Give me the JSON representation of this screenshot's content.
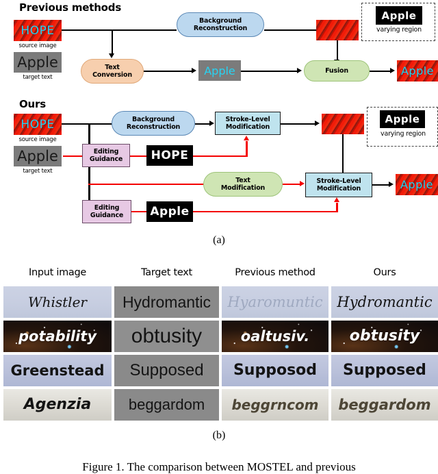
{
  "figure": {
    "subfigure_a_label": "(a)",
    "subfigure_b_label": "(b)",
    "caption": "Figure 1.  The comparison between MOSTEL and previous"
  },
  "panel_a": {
    "previous": {
      "title": "Previous methods",
      "source_image_label": "source image",
      "source_image_text": "HOPE",
      "target_text_label": "target text",
      "target_text_value": "Apple",
      "nodes": [
        {
          "id": "background-reconstruction",
          "line1": "Background",
          "line2": "Reconstruction",
          "color": "#bcd8ef"
        },
        {
          "id": "text-conversion",
          "line1": "Text",
          "line2": "Conversion",
          "color": "#f7cfae"
        },
        {
          "id": "fusion",
          "line1": "Fusion",
          "line2": "",
          "color": "#cfe5b4"
        }
      ],
      "converted_text": "Apple",
      "output_text": "Apple",
      "varying_region_label": "varying region",
      "varying_region_text": "Apple"
    },
    "ours": {
      "title": "Ours",
      "source_image_label": "source image",
      "source_image_text": "HOPE",
      "target_text_label": "target text",
      "target_text_value": "Apple",
      "nodes": [
        {
          "id": "background-reconstruction",
          "line1": "Background",
          "line2": "Reconstruction",
          "color": "#bcd8ef"
        },
        {
          "id": "stroke-level-modification-top",
          "line1": "Stroke-Level",
          "line2": "Modification",
          "color": "#bfe3ee"
        },
        {
          "id": "editing-guidance-top",
          "line1": "Editing",
          "line2": "Guidance",
          "color": "#e7c9e4"
        },
        {
          "id": "text-modification",
          "line1": "Text",
          "line2": "Modification",
          "color": "#cfe5b4"
        },
        {
          "id": "stroke-level-modification-bottom",
          "line1": "Stroke-Level",
          "line2": "Modification",
          "color": "#bfe3ee"
        },
        {
          "id": "editing-guidance-bottom",
          "line1": "Editing",
          "line2": "Guidance",
          "color": "#e7c9e4"
        }
      ],
      "mask_hope": "HOPE",
      "mask_apple": "Apple",
      "output_text": "Apple",
      "varying_region_label": "varying region",
      "varying_region_text": "Apple"
    }
  },
  "panel_b": {
    "headers": [
      "Input image",
      "Target text",
      "Previous method",
      "Ours"
    ],
    "rows": [
      {
        "input_image": "Whistler",
        "target_text": "Hydromantic",
        "previous_method": "Hyaromuntic",
        "ours": "Hydromantic"
      },
      {
        "input_image": "potability",
        "target_text": "obtusity",
        "previous_method": "oaltusiv.",
        "ours": "obtusity"
      },
      {
        "input_image": "Greenstead",
        "target_text": "Supposed",
        "previous_method": "Supposod",
        "ours": "Supposed"
      },
      {
        "input_image": "Agenzia",
        "target_text": "beggardom",
        "previous_method": "beggrncom",
        "ours": "beggardom"
      }
    ]
  },
  "colors": {
    "accent_red": "#f40000",
    "node_blue": "#bcd8ef",
    "node_cyan": "#bfe3ee",
    "node_peach": "#f7cfae",
    "node_green": "#cfe5b4",
    "node_purple": "#e7c9e4",
    "text_cyan": "#27d3f2"
  }
}
